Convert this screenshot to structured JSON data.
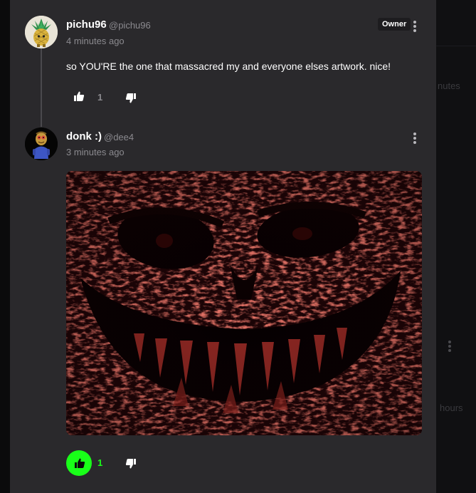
{
  "comments": [
    {
      "username": "pichu96",
      "handle": "@pichu96",
      "time": "4 minutes ago",
      "badge": "Owner",
      "text": "so YOU'RE the one that massacred my and everyone elses artwork. nice!",
      "likes": "1",
      "avatar_icon": "pineapple-avatar-icon"
    },
    {
      "username": "donk :)",
      "handle": "@dee4",
      "time": "3 minutes ago",
      "likes": "1",
      "liked": true,
      "attachment": "dark red distorted face image",
      "avatar_icon": "character-avatar-icon"
    }
  ],
  "background": {
    "partial_text_1": "nutes",
    "partial_text_2": "hours"
  },
  "colors": {
    "panel": "#2a292c",
    "like_active": "#19ff19",
    "muted_text": "#8b8a8f"
  }
}
